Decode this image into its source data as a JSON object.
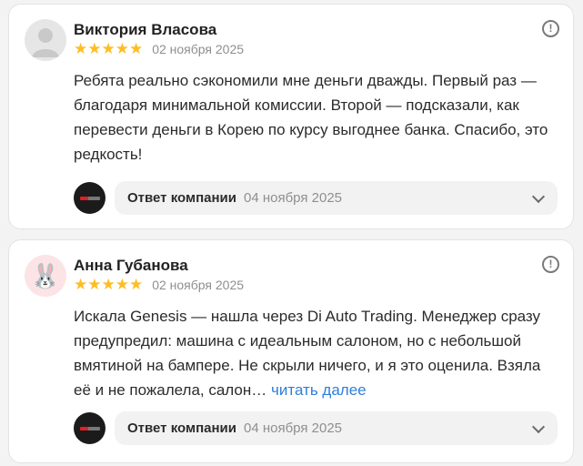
{
  "reviews": [
    {
      "author": "Виктория Власова",
      "rating": 5,
      "stars": "★★★★★",
      "date": "02 ноября 2025",
      "text": "Ребята реально сэкономили мне деньги дважды. Первый раз — благодаря минимальной комиссии. Второй — подсказали, как перевести деньги в Корею по курсу выгоднее банка. Спасибо, это редкость!",
      "read_more": "",
      "reply_label": "Ответ компании",
      "reply_date": "04 ноября 2025"
    },
    {
      "author": "Анна Губанова",
      "avatar_emoji": "🐰",
      "rating": 5,
      "stars": "★★★★★",
      "date": "02 ноября 2025",
      "text": "Искала Genesis — нашла через Di Auto Trading. Менеджер сразу предупредил: машина с идеальным салоном, но с небольшой вмятиной на бампере. Не скрыли ничего, и я это оценила. Взяла её и не пожалела, салон…",
      "read_more": "читать далее",
      "reply_label": "Ответ компании",
      "reply_date": "04 ноября 2025"
    }
  ],
  "icons": {
    "info": "!",
    "default_avatar": "user-placeholder-icon",
    "company_logo": "company-logo-icon",
    "chevron": "chevron-down-icon"
  },
  "colors": {
    "star": "#fcbd26",
    "link": "#2f7fd9",
    "muted": "#8f8f8f"
  }
}
